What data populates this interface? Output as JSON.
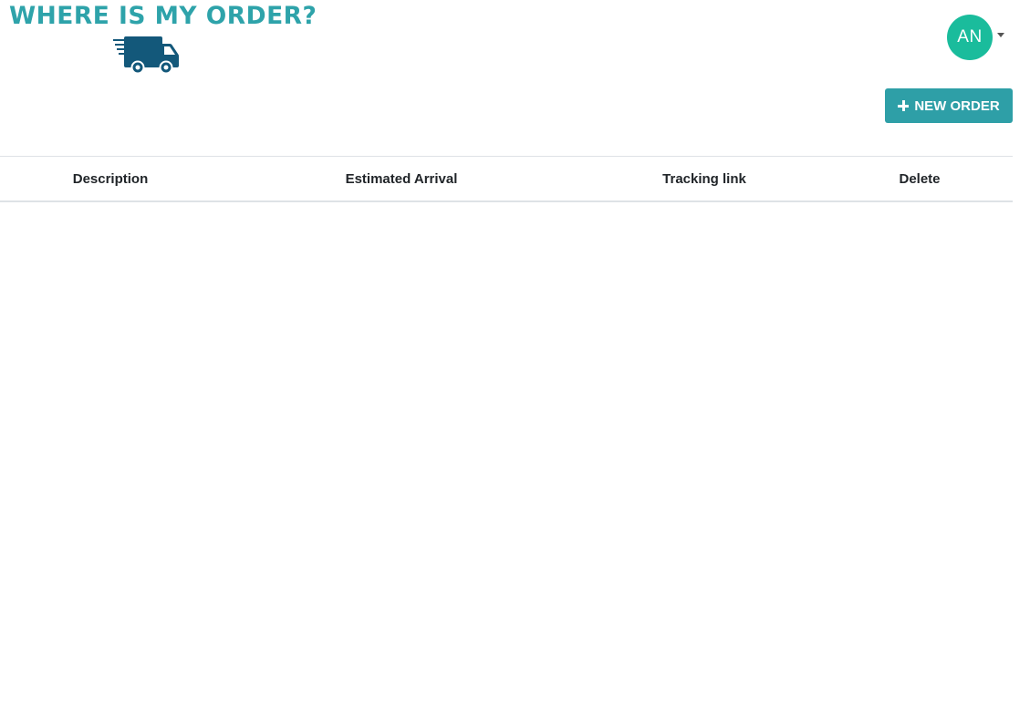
{
  "logo": {
    "title": "WHERE IS MY ORDER?",
    "icon": "delivery-truck-icon"
  },
  "user": {
    "initials": "AN",
    "avatar_color": "#1abc9c"
  },
  "toolbar": {
    "new_order_label": "NEW ORDER",
    "new_order_icon": "plus-icon",
    "button_color": "#2e9fa7"
  },
  "table": {
    "columns": [
      "Description",
      "Estimated Arrival",
      "Tracking link",
      "Delete"
    ],
    "rows": []
  }
}
